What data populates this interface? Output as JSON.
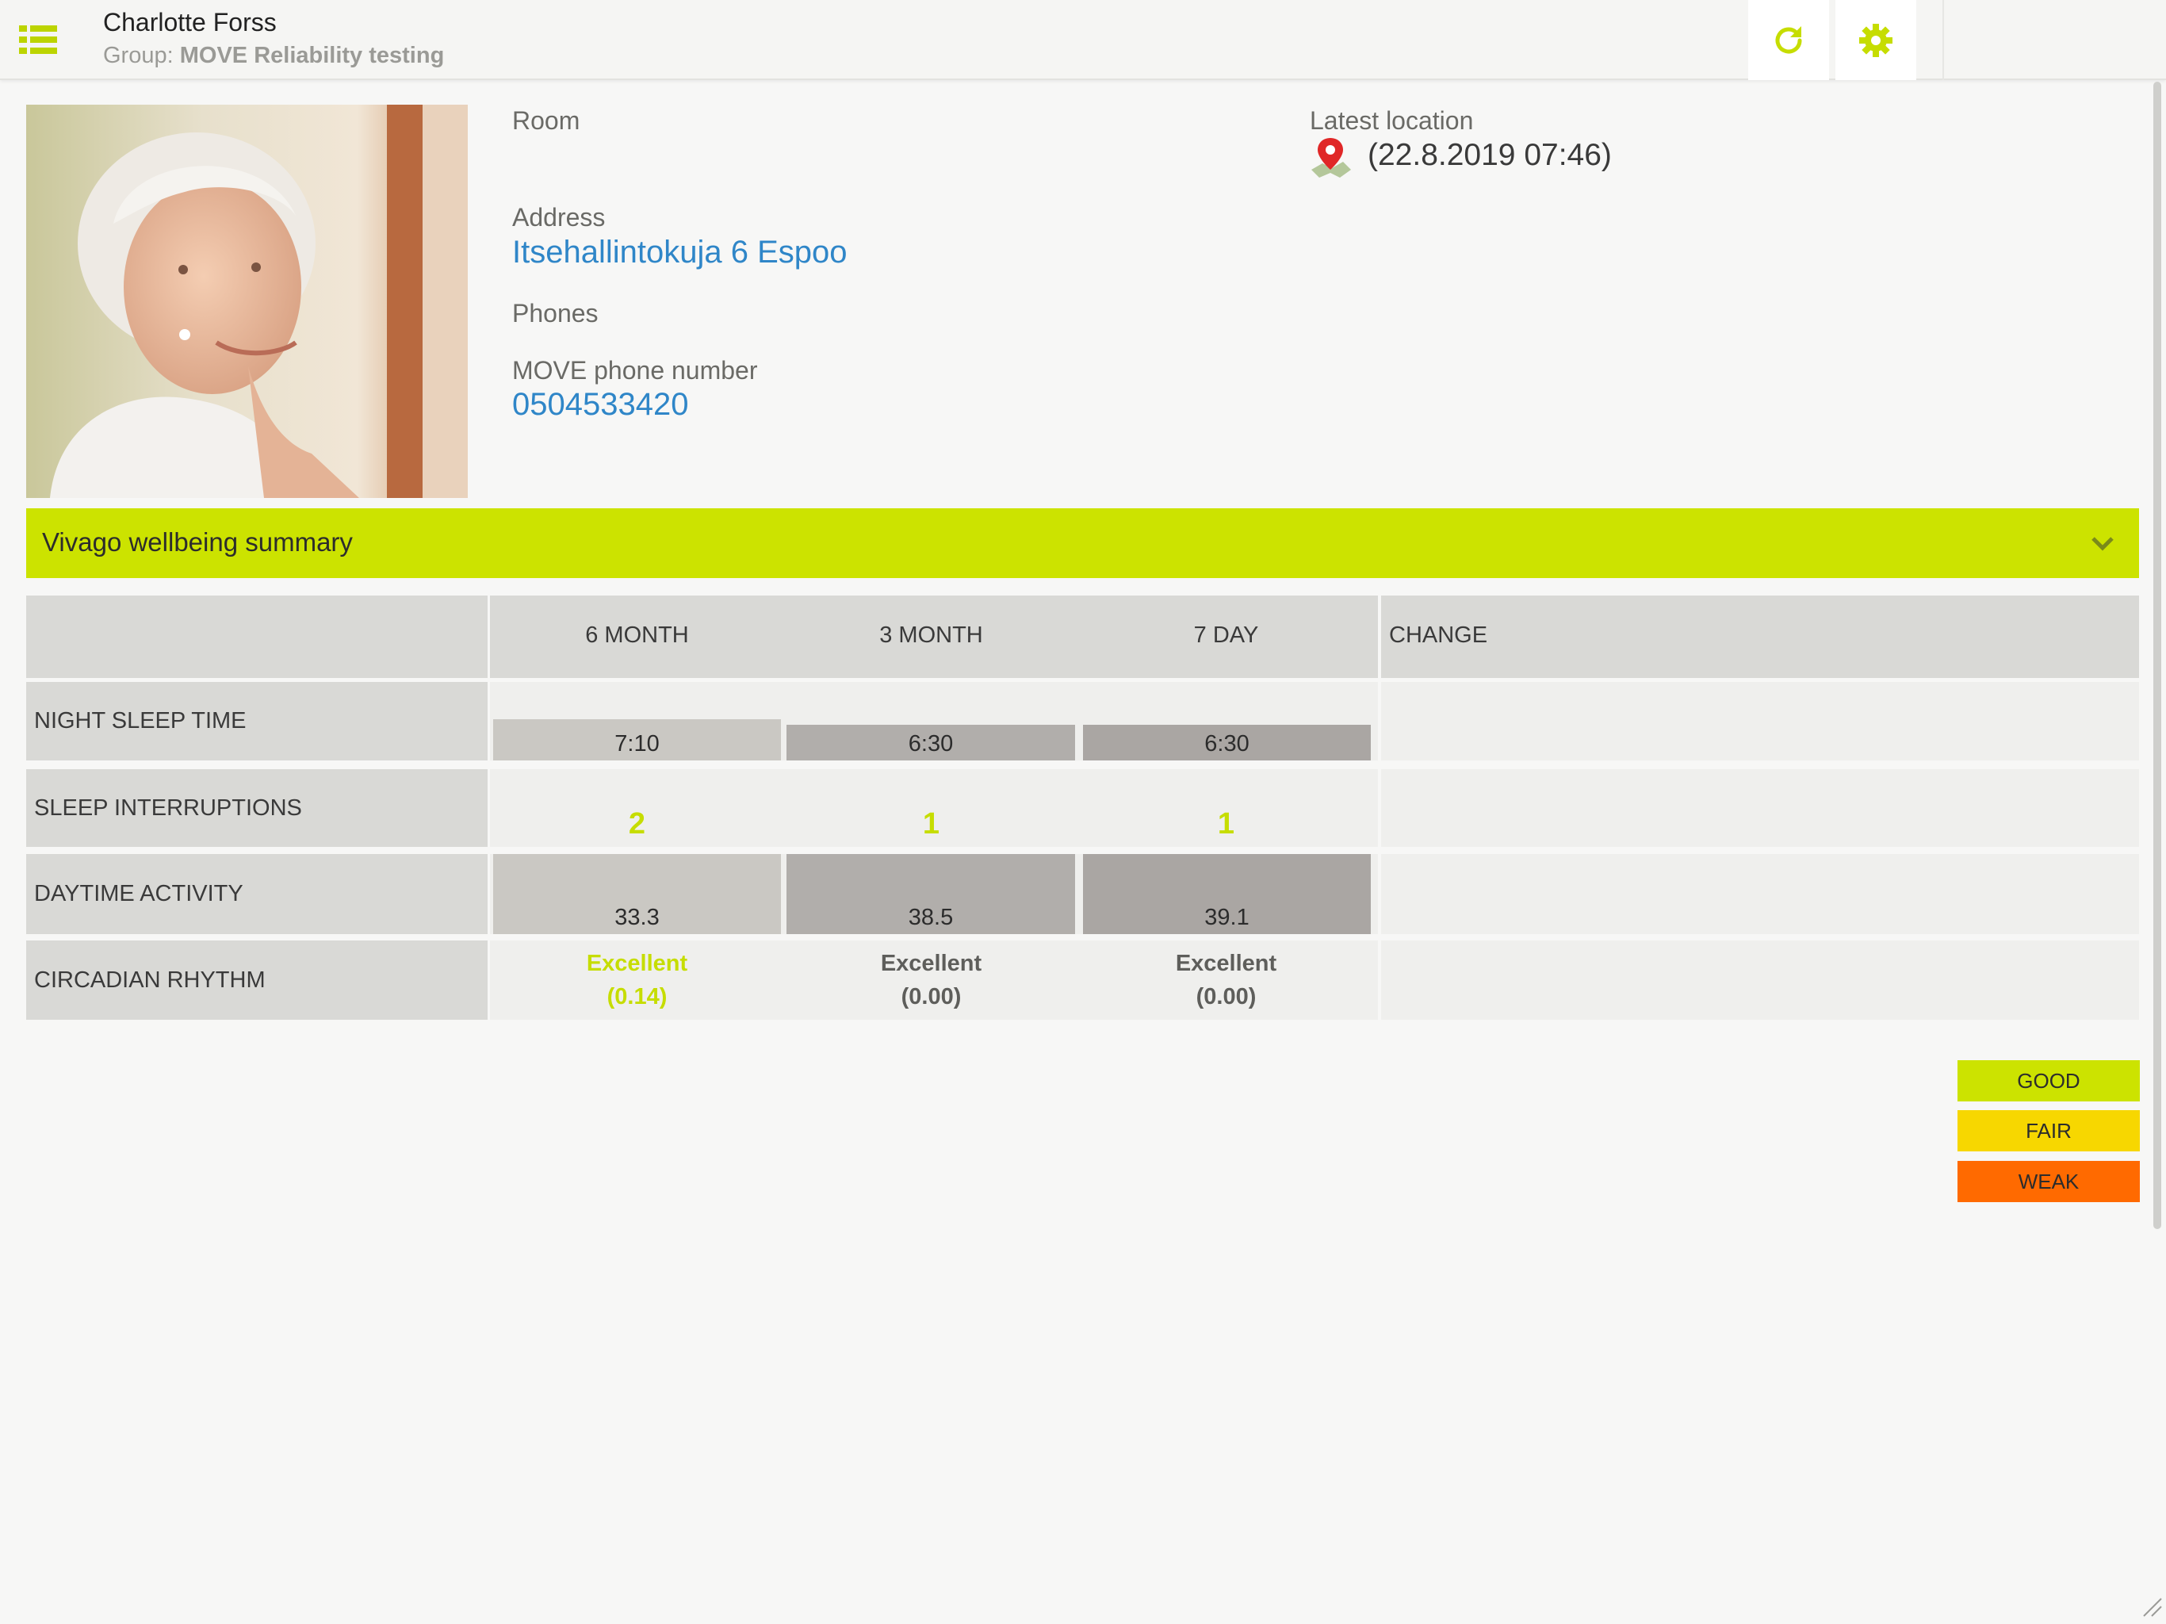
{
  "header": {
    "patient_name": "Charlotte Forss",
    "group_prefix": "Group:",
    "group_name": "MOVE Reliability testing",
    "menu_icon": "list-icon",
    "refresh_icon": "refresh-icon",
    "settings_icon": "gear-icon"
  },
  "profile": {
    "room_label": "Room",
    "address_label": "Address",
    "address_value": "Itsehallintokuja 6 Espoo",
    "phones_label": "Phones",
    "move_phone_label": "MOVE phone number",
    "move_phone_value": "0504533420",
    "latest_location_label": "Latest location",
    "latest_location_value": "(22.8.2019 07:46)",
    "location_icon": "map-pin-icon"
  },
  "summary": {
    "title": "Vivago wellbeing summary",
    "columns": [
      "6 MONTH",
      "3 MONTH",
      "7 DAY",
      "CHANGE"
    ],
    "rows": {
      "night_sleep": {
        "label": "NIGHT SLEEP TIME",
        "values": [
          "7:10",
          "6:30",
          "6:30"
        ],
        "hours": [
          7.17,
          6.5,
          6.5
        ]
      },
      "interruptions": {
        "label": "SLEEP INTERRUPTIONS",
        "values": [
          "2",
          "1",
          "1"
        ]
      },
      "daytime_activity": {
        "label": "DAYTIME ACTIVITY",
        "values": [
          "33.3",
          "38.5",
          "39.1"
        ]
      },
      "circadian": {
        "label": "CIRCADIAN RHYTHM",
        "values": [
          {
            "rating": "Excellent",
            "score": "(0.14)"
          },
          {
            "rating": "Excellent",
            "score": "(0.00)"
          },
          {
            "rating": "Excellent",
            "score": "(0.00)"
          }
        ]
      }
    }
  },
  "legend": {
    "good": "GOOD",
    "fair": "FAIR",
    "weak": "WEAK"
  },
  "colors": {
    "accent": "#cce300",
    "good": "#cce300",
    "fair": "#f7d700",
    "weak": "#ff6a00",
    "link": "#2f86c8"
  }
}
